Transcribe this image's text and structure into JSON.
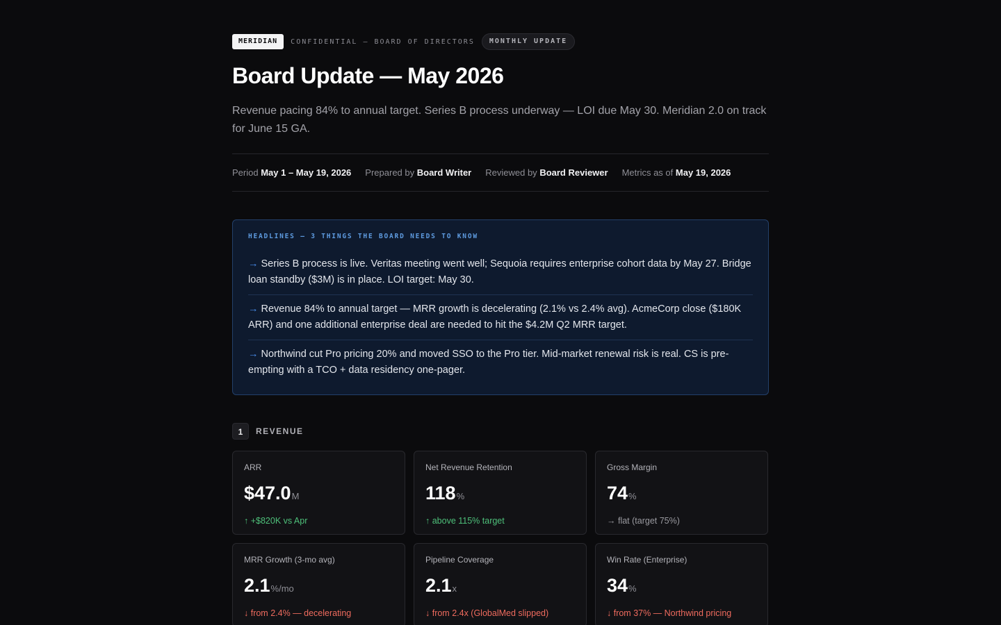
{
  "header": {
    "brand": "MERIDIAN",
    "confidential": "CONFIDENTIAL — BOARD OF DIRECTORS",
    "pill": "MONTHLY UPDATE",
    "title": "Board Update — May 2026",
    "summary": "Revenue pacing 84% to annual target. Series B process underway — LOI due May 30. Meridian 2.0 on track for June 15 GA."
  },
  "meta": {
    "period_label": "Period",
    "period_value": "May 1 – May 19, 2026",
    "prepared_label": "Prepared by",
    "prepared_value": "Board Writer",
    "reviewed_label": "Reviewed by",
    "reviewed_value": "Board Reviewer",
    "metrics_label": "Metrics as of",
    "metrics_value": "May 19, 2026"
  },
  "headlines": {
    "label": "HEADLINES — 3 THINGS THE BOARD NEEDS TO KNOW",
    "arrow": "→",
    "items": [
      "Series B process is live. Veritas meeting went well; Sequoia requires enterprise cohort data by May 27. Bridge loan standby ($3M) is in place. LOI target: May 30.",
      "Revenue 84% to annual target — MRR growth is decelerating (2.1% vs 2.4% avg). AcmeCorp close ($180K ARR) and one additional enterprise deal are needed to hit the $4.2M Q2 MRR target.",
      "Northwind cut Pro pricing 20% and moved SSO to the Pro tier. Mid-market renewal risk is real. CS is pre-empting with a TCO + data residency one-pager."
    ]
  },
  "section": {
    "number": "1",
    "title": "REVENUE"
  },
  "cards": [
    {
      "label": "ARR",
      "value": "$47.0",
      "unit": "M",
      "delta": "↑ +$820K vs Apr",
      "trend": "up"
    },
    {
      "label": "Net Revenue Retention",
      "value": "118",
      "unit": "%",
      "delta": "↑ above 115% target",
      "trend": "up"
    },
    {
      "label": "Gross Margin",
      "value": "74",
      "unit": "%",
      "delta": "→ flat (target 75%)",
      "trend": "flat"
    },
    {
      "label": "MRR Growth (3-mo avg)",
      "value": "2.1",
      "unit": "%/mo",
      "delta": "↓ from 2.4% — decelerating",
      "trend": "down"
    },
    {
      "label": "Pipeline Coverage",
      "value": "2.1",
      "unit": "x",
      "delta": "↓ from 2.4x (GlobalMed slipped)",
      "trend": "down"
    },
    {
      "label": "Win Rate (Enterprise)",
      "value": "34",
      "unit": "%",
      "delta": "↓ from 37% — Northwind pricing",
      "trend": "down"
    }
  ],
  "colors": {
    "up": "#4ec07a",
    "down": "#ef6b5e",
    "flat": "#9a9aa0",
    "accent": "#4a8ff0"
  }
}
